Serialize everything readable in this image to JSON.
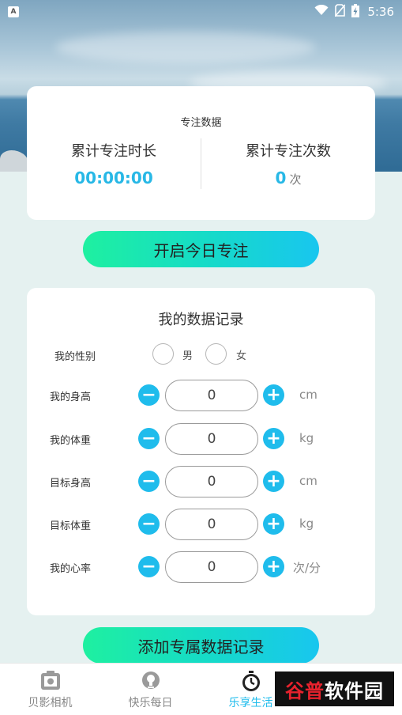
{
  "status_bar": {
    "app_badge": "A",
    "time": "5:36",
    "icons": [
      "wifi-icon",
      "no-sim-icon",
      "battery-charging-icon"
    ]
  },
  "focus_card": {
    "title": "专注数据",
    "total_time_label": "累计专注时长",
    "total_time_value": "00:00:00",
    "total_count_label": "累计专注次数",
    "total_count_value": "0",
    "total_count_unit": "次"
  },
  "start_button": "开启今日专注",
  "records": {
    "title": "我的数据记录",
    "gender_label": "我的性别",
    "gender_options": [
      "男",
      "女"
    ],
    "fields": [
      {
        "label": "我的身高",
        "value": "0",
        "unit": "cm"
      },
      {
        "label": "我的体重",
        "value": "0",
        "unit": "kg"
      },
      {
        "label": "目标身高",
        "value": "0",
        "unit": "cm"
      },
      {
        "label": "目标体重",
        "value": "0",
        "unit": "kg"
      },
      {
        "label": "我的心率",
        "value": "0",
        "unit": "次/分"
      }
    ]
  },
  "add_button": "添加专属数据记录",
  "tabs": [
    {
      "label": "贝影相机",
      "icon": "camera-icon",
      "active": false
    },
    {
      "label": "快乐每日",
      "icon": "lightbulb-icon",
      "active": false
    },
    {
      "label": "乐享生活",
      "icon": "stopwatch-icon",
      "active": true
    }
  ],
  "watermark": {
    "text_a": "谷普",
    "text_b": "软件园"
  },
  "colors": {
    "accent": "#1fbcec",
    "gradient_start": "#1ef0a0",
    "gradient_end": "#18c6ef",
    "background": "#e5f1f0"
  }
}
